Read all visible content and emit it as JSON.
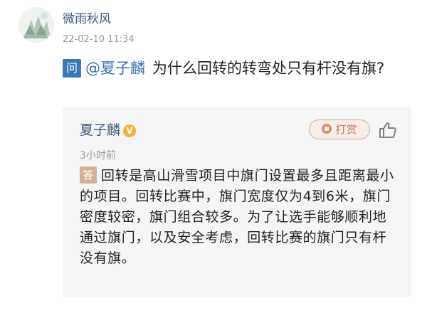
{
  "asker": {
    "name": "微雨秋风",
    "time": "22-02-10 11:34",
    "avatar_icon": "avatar-icon"
  },
  "question": {
    "badge": "问",
    "mention": "@夏子麟",
    "text": "为什么回转的转弯处只有杆没有旗?"
  },
  "answer": {
    "author": "夏子麟",
    "verified_badge": "V",
    "time": "3小时前",
    "tip_label": "打赏",
    "badge": "答",
    "text": "回转是高山滑雪项目中旗门设置最多且距离最小的项目。回转比赛中，旗门宽度仅为4到6米，旗门密度较密，旗门组合较多。为了让选手能够顺利地通过旗门，以及安全考虑，回转比赛的旗门只有杆没有旗。"
  },
  "colors": {
    "name_link": "#3d5a7a",
    "question_badge": "#3a78b7",
    "answer_badge": "#d4b196",
    "tip_accent": "#c47a57",
    "card_bg": "#f5f5f5"
  }
}
